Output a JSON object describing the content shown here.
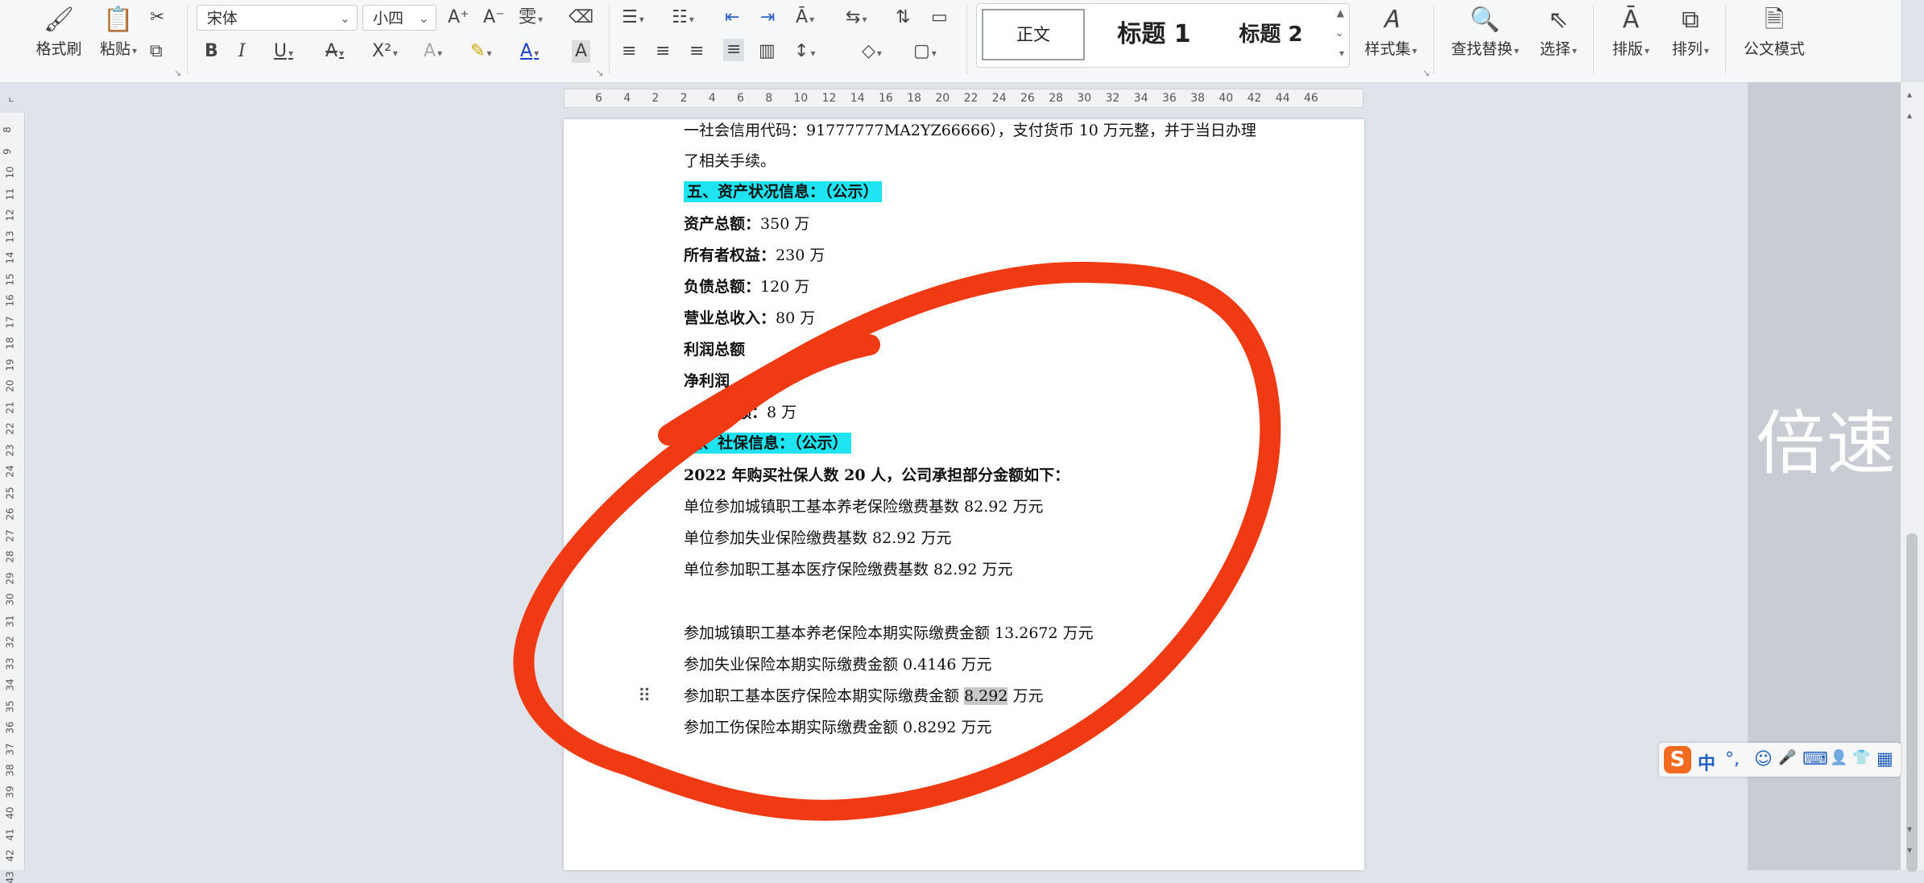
{
  "toolbar": {
    "format_painter": "格式刷",
    "paste": "粘贴",
    "font_name": "宋体",
    "font_size": "小四",
    "styles": {
      "normal": "正文",
      "heading1": "标题 1",
      "heading2": "标题 2"
    },
    "style_set": "样式集",
    "find_replace": "查找替换",
    "select": "选择",
    "layout": "排版",
    "arrange": "排列",
    "official_mode": "公文模式",
    "icons": {
      "font_grow": "A⁺",
      "font_shrink": "A⁻",
      "phonetic": "变",
      "bold": "B",
      "italic": "I",
      "underline": "U",
      "strike": "A",
      "superscript": "X²",
      "text_effect": "A",
      "highlight": "✎",
      "font_color": "A",
      "char_shade": "A"
    }
  },
  "ruler": {
    "h_ticks": [
      "6",
      "4",
      "2",
      "2",
      "4",
      "6",
      "8",
      "10",
      "12",
      "14",
      "16",
      "18",
      "20",
      "22",
      "24",
      "26",
      "28",
      "30",
      "32",
      "34",
      "36",
      "38",
      "40",
      "42",
      "44",
      "46"
    ],
    "v_ticks": [
      "8",
      "9",
      "10",
      "11",
      "12",
      "13",
      "14",
      "15",
      "16",
      "17",
      "18",
      "19",
      "20",
      "21",
      "22",
      "23",
      "24",
      "25",
      "26",
      "27",
      "28",
      "29",
      "30",
      "31",
      "32",
      "33",
      "34",
      "35",
      "36",
      "37",
      "38",
      "39",
      "40",
      "41",
      "42",
      "43"
    ]
  },
  "document": {
    "l1": "一社会信用代码：91777777MA2YZ66666），支付货币 10 万元整，并于当日办理",
    "l2": "了相关手续。",
    "h5": "五、资产状况信息：（公示）",
    "assets_label": "资产总额：",
    "assets_value": "350 万",
    "equity_label": "所有者权益：",
    "equity_value": "230 万",
    "liab_label": "负债总额：",
    "liab_value": "120 万",
    "revenue_label": "营业总收入：",
    "revenue_value": "80 万",
    "profit_label": "利润总额",
    "net_label": "净利润",
    "tax_label": "税总额：",
    "tax_value": "8 万",
    "h6": "六、社保信息：（公示）",
    "ss_intro": "2022 年购买社保人数 20 人，公司承担部分金额如下：",
    "base1": "单位参加城镇职工基本养老保险缴费基数 82.92 万元",
    "base2": "单位参加失业保险缴费基数 82.92 万元",
    "base3": "单位参加职工基本医疗保险缴费基数 82.92 万元",
    "paid1": "参加城镇职工基本养老保险本期实际缴费金额 13.2672 万元",
    "paid2": "参加失业保险本期实际缴费金额 0.4146 万元",
    "paid3_pre": "参加职工基本医疗保险本期实际缴费金额 ",
    "paid3_sel": "8.292",
    "paid3_post": " 万元",
    "paid4": "参加工伤保险本期实际缴费金额 0.8292 万元"
  },
  "overlay": {
    "speed_label": "倍速"
  },
  "ime": {
    "logo": "S",
    "lang": "中",
    "punct": "°,",
    "emoji": "☺",
    "mic": "🎤",
    "keyboard": "⌨",
    "user": "👤",
    "skin": "👕",
    "apps": "▦"
  },
  "colors": {
    "scribble": "#f03a14",
    "highlight": "#1ee4f2",
    "ime_logo": "#f36b21"
  }
}
